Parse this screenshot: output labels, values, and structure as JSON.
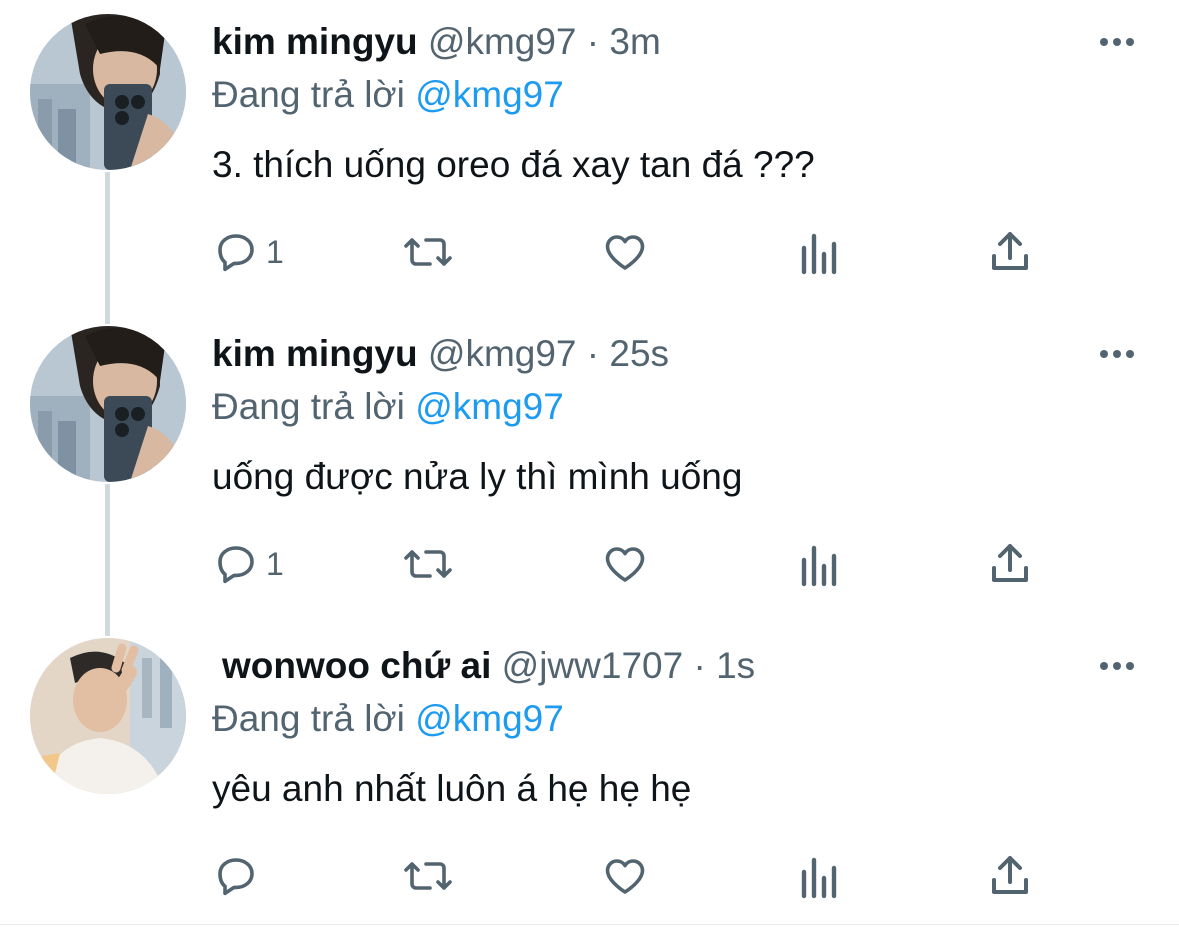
{
  "tweets": [
    {
      "name": "kim mingyu",
      "handle": "@kmg97",
      "dot": "·",
      "time": "3m",
      "reply_prefix": "Đang trả lời",
      "reply_to": "@kmg97",
      "text": "3. thích uống oreo đá xay tan đá ???",
      "reply_count": "1",
      "icons": [
        "reply-icon",
        "retweet-icon",
        "like-icon",
        "analytics-icon",
        "share-icon",
        "more-icon"
      ]
    },
    {
      "name": "kim mingyu",
      "handle": "@kmg97",
      "dot": "·",
      "time": "25s",
      "reply_prefix": "Đang trả lời",
      "reply_to": "@kmg97",
      "text": "uống được nửa ly thì mình uống",
      "reply_count": "1",
      "icons": [
        "reply-icon",
        "retweet-icon",
        "like-icon",
        "analytics-icon",
        "share-icon",
        "more-icon"
      ]
    },
    {
      "name": "wonwoo chứ ai",
      "handle": "@jww1707",
      "dot": "·",
      "time": "1s",
      "reply_prefix": "Đang trả lời",
      "reply_to": "@kmg97",
      "text": "yêu anh nhất luôn á hẹ hẹ hẹ",
      "reply_count": "",
      "icons": [
        "reply-icon",
        "retweet-icon",
        "like-icon",
        "analytics-icon",
        "share-icon",
        "more-icon"
      ]
    }
  ],
  "colors": {
    "text": "#0f1419",
    "secondary": "#536471",
    "mention": "#1d9bf0",
    "thread_line": "#cfd9de"
  }
}
